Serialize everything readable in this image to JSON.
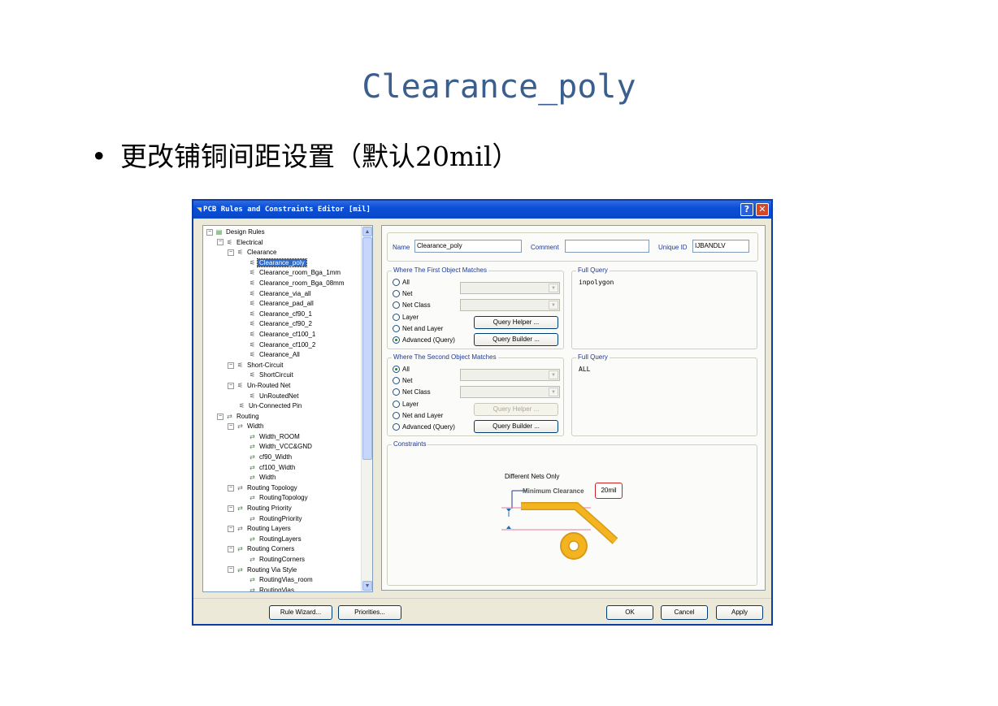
{
  "slide": {
    "title": "Clearance_poly",
    "bullet": "更改铺铜间距设置（默认20mil）"
  },
  "dialog": {
    "title": "PCB Rules and Constraints Editor [mil]",
    "help": "?",
    "close": "✕",
    "tree": [
      {
        "label": "Design Rules",
        "level": 0,
        "exp": "-",
        "icon": "rules"
      },
      {
        "label": "Electrical",
        "level": 1,
        "exp": "-",
        "icon": "rule"
      },
      {
        "label": "Clearance",
        "level": 2,
        "exp": "-",
        "icon": "rule"
      },
      {
        "label": "Clearance_poly",
        "level": 3,
        "icon": "rule",
        "selected": true
      },
      {
        "label": "Clearance_room_Bga_1mm",
        "level": 3,
        "icon": "rule"
      },
      {
        "label": "Clearance_room_Bga_08mm",
        "level": 3,
        "icon": "rule"
      },
      {
        "label": "Clearance_via_all",
        "level": 3,
        "icon": "rule"
      },
      {
        "label": "Clearance_pad_all",
        "level": 3,
        "icon": "rule"
      },
      {
        "label": "Clearance_cf90_1",
        "level": 3,
        "icon": "rule"
      },
      {
        "label": "Clearance_cf90_2",
        "level": 3,
        "icon": "rule"
      },
      {
        "label": "Clearance_cf100_1",
        "level": 3,
        "icon": "rule"
      },
      {
        "label": "Clearance_cf100_2",
        "level": 3,
        "icon": "rule"
      },
      {
        "label": "Clearance_All",
        "level": 3,
        "icon": "rule"
      },
      {
        "label": "Short-Circuit",
        "level": 2,
        "exp": "-",
        "icon": "rule"
      },
      {
        "label": "ShortCircuit",
        "level": 3,
        "icon": "rule"
      },
      {
        "label": "Un-Routed Net",
        "level": 2,
        "exp": "-",
        "icon": "rule"
      },
      {
        "label": "UnRoutedNet",
        "level": 3,
        "icon": "rule"
      },
      {
        "label": "Un-Connected Pin",
        "level": 2,
        "icon": "rule"
      },
      {
        "label": "Routing",
        "level": 1,
        "exp": "-",
        "icon": "route"
      },
      {
        "label": "Width",
        "level": 2,
        "exp": "-",
        "icon": "route"
      },
      {
        "label": "Width_ROOM",
        "level": 3,
        "icon": "route"
      },
      {
        "label": "Width_VCC&GND",
        "level": 3,
        "icon": "route"
      },
      {
        "label": "cf90_Width",
        "level": 3,
        "icon": "route"
      },
      {
        "label": "cf100_Width",
        "level": 3,
        "icon": "route"
      },
      {
        "label": "Width",
        "level": 3,
        "icon": "route"
      },
      {
        "label": "Routing Topology",
        "level": 2,
        "exp": "-",
        "icon": "route"
      },
      {
        "label": "RoutingTopology",
        "level": 3,
        "icon": "route"
      },
      {
        "label": "Routing Priority",
        "level": 2,
        "exp": "-",
        "icon": "route"
      },
      {
        "label": "RoutingPriority",
        "level": 3,
        "icon": "route"
      },
      {
        "label": "Routing Layers",
        "level": 2,
        "exp": "-",
        "icon": "route"
      },
      {
        "label": "RoutingLayers",
        "level": 3,
        "icon": "route"
      },
      {
        "label": "Routing Corners",
        "level": 2,
        "exp": "-",
        "icon": "route"
      },
      {
        "label": "RoutingCorners",
        "level": 3,
        "icon": "route"
      },
      {
        "label": "Routing Via Style",
        "level": 2,
        "exp": "-",
        "icon": "route"
      },
      {
        "label": "RoutingVias_room",
        "level": 3,
        "icon": "route"
      },
      {
        "label": "RoutingVias",
        "level": 3,
        "icon": "route"
      }
    ],
    "rule": {
      "name_label": "Name",
      "name_value": "Clearance_poly",
      "comment_label": "Comment",
      "comment_value": "",
      "uid_label": "Unique ID",
      "uid_value": "IJBANDLV"
    },
    "first": {
      "title": "Where The First Object Matches",
      "options": [
        "All",
        "Net",
        "Net Class",
        "Layer",
        "Net and Layer",
        "Advanced (Query)"
      ],
      "selected": "Advanced (Query)",
      "query_helper": "Query Helper ...",
      "query_builder": "Query Builder ...",
      "full_query_title": "Full Query",
      "full_query": "inpolygon"
    },
    "second": {
      "title": "Where The Second Object Matches",
      "options": [
        "All",
        "Net",
        "Net Class",
        "Layer",
        "Net and Layer",
        "Advanced (Query)"
      ],
      "selected": "All",
      "query_helper": "Query Helper ...",
      "query_builder": "Query Builder ...",
      "full_query_title": "Full Query",
      "full_query": "ALL"
    },
    "constraints": {
      "title": "Constraints",
      "diff_nets": "Different Nets Only",
      "min_clearance_label": "Minimum Clearance",
      "min_clearance_value": "20mil"
    },
    "buttons": {
      "rule_wizard": "Rule Wizard...",
      "priorities": "Priorities...",
      "ok": "OK",
      "cancel": "Cancel",
      "apply": "Apply"
    }
  }
}
